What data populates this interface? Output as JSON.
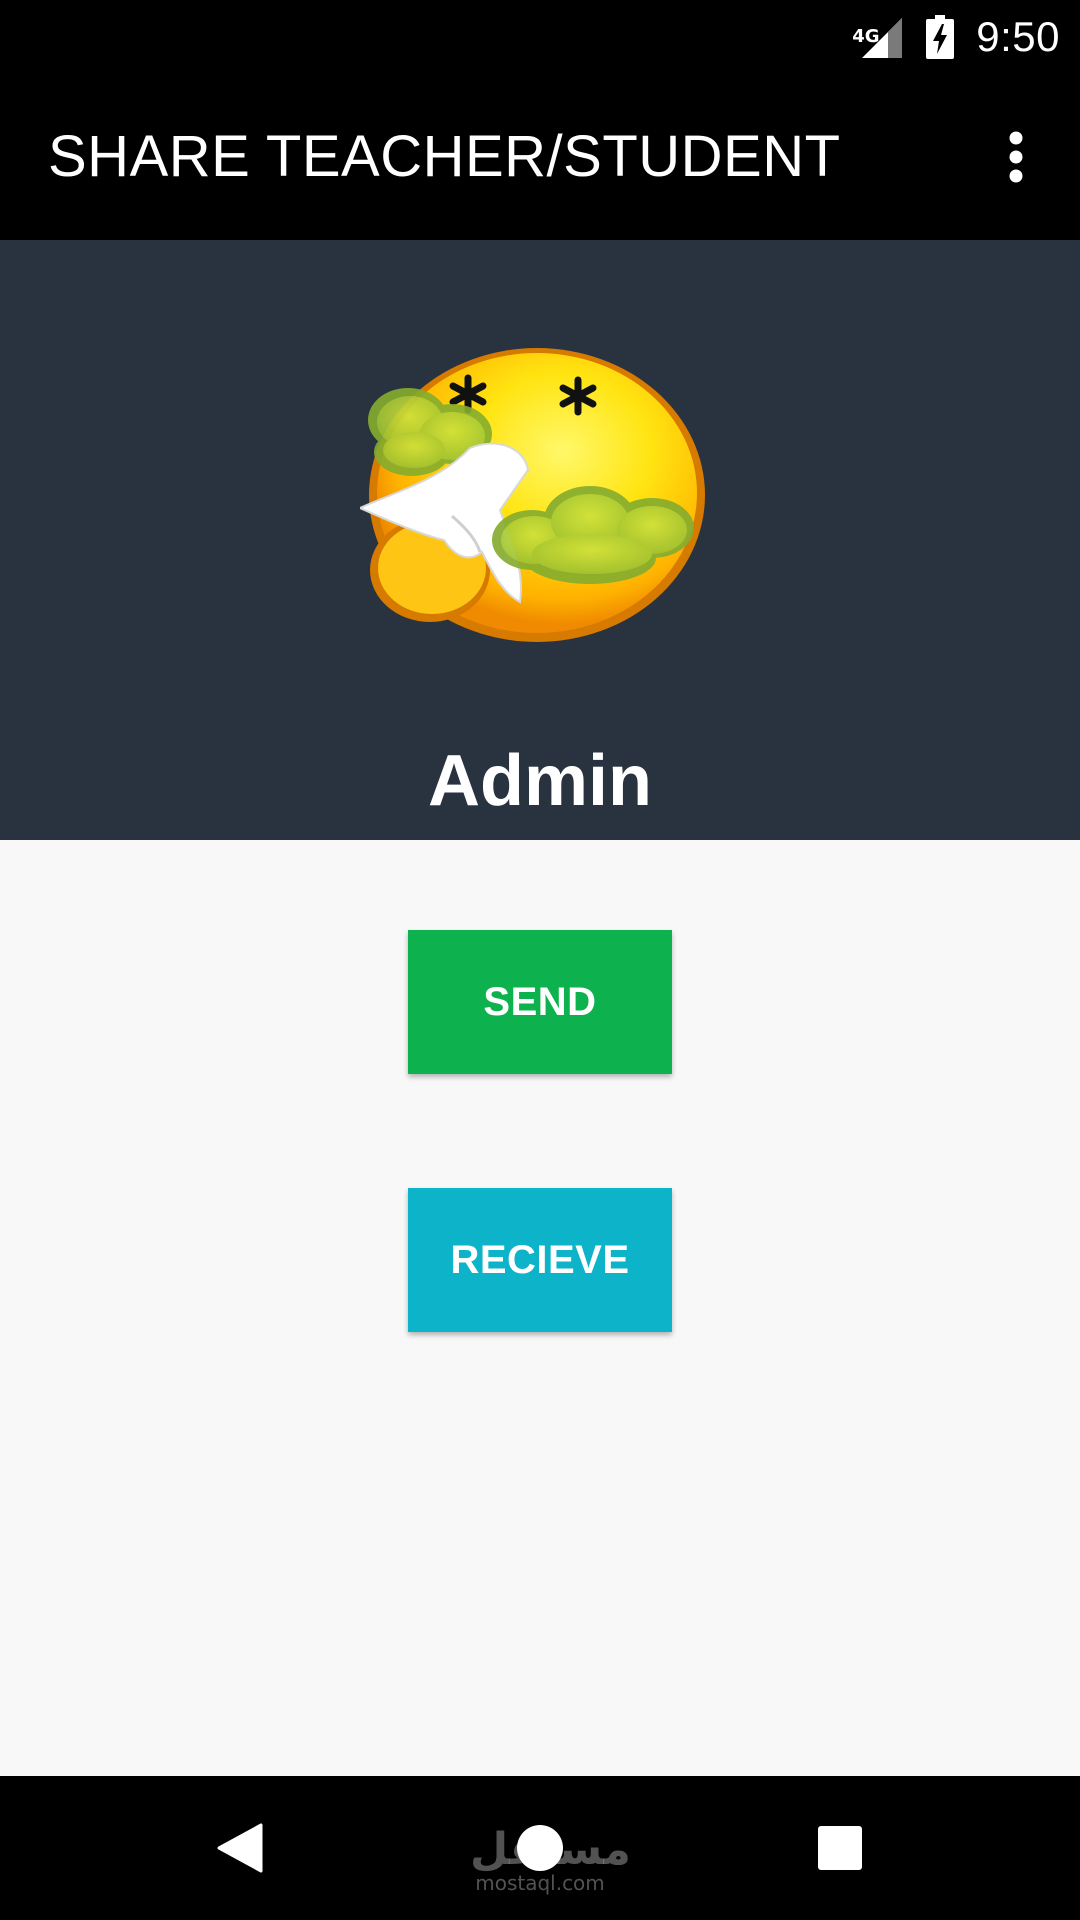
{
  "status_bar": {
    "network_type": "4G",
    "time": "9:50",
    "icons": [
      "signal-icon",
      "battery-charging-icon"
    ]
  },
  "app_bar": {
    "title": "SHARE TEACHER/STUDENT",
    "menu_icon": "more-vert-icon"
  },
  "profile": {
    "name": "Admin",
    "avatar_icon": "sick-emoji-icon"
  },
  "actions": {
    "send_label": "SEND",
    "recieve_label": "RECIEVE"
  },
  "nav_bar": {
    "icons": [
      "back-icon",
      "home-icon",
      "recents-icon"
    ],
    "watermark_ar": "مستقل",
    "watermark_en": "mostaql.com"
  },
  "colors": {
    "header_bg": "#293340",
    "send": "#0db24f",
    "recieve": "#0db3c8",
    "bars": "#000000",
    "content_bg": "#f8f8f8"
  }
}
